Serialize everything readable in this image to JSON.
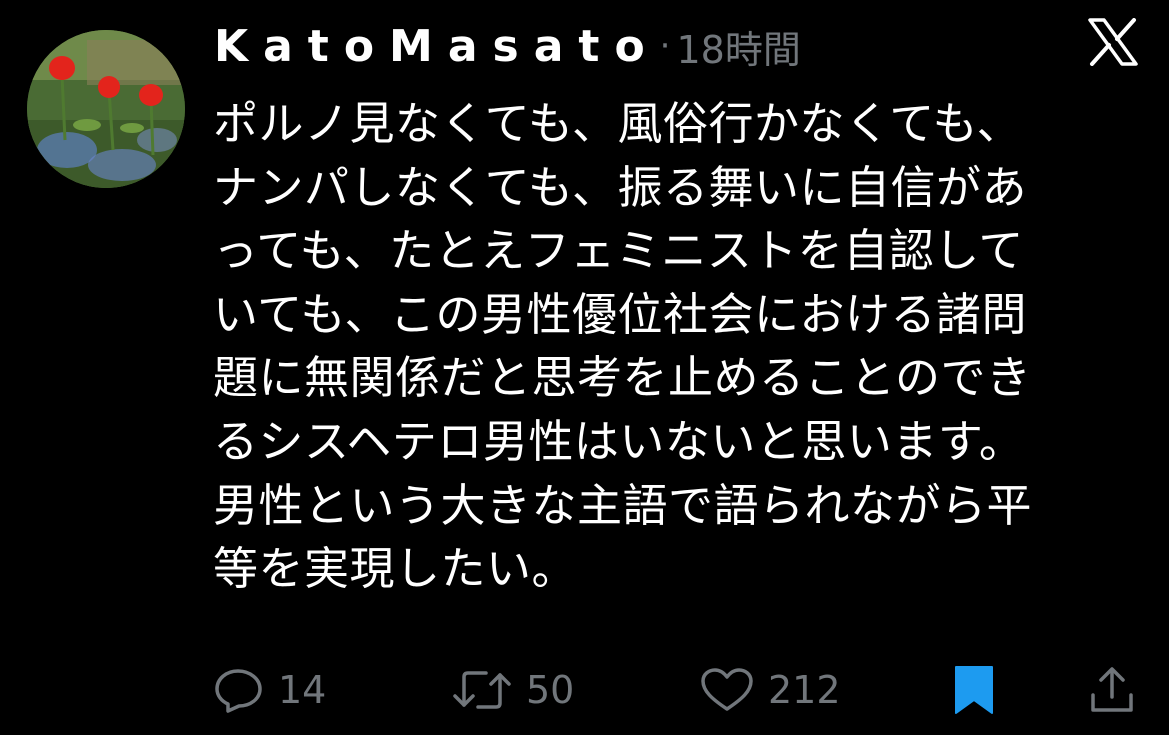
{
  "tweet": {
    "author": {
      "display_name": "KatoMasato",
      "avatar_icon": "tulips-avatar"
    },
    "separator": "·",
    "timestamp": "18時間",
    "brand_icon": "x-logo-icon",
    "text_lines": [
      "ポルノ見なくても、風俗行かなくても、",
      "ナンパしなくても、振る舞いに自信があ",
      "っても、たとえフェミニストを自認して",
      "いても、この男性優位社会における諸問",
      "題に無関係だと思考を止めることのでき",
      "るシスヘテロ男性はいないと思います。",
      "男性という大きな主語で語られながら平",
      "等を実現したい。"
    ],
    "actions": {
      "reply": {
        "icon": "reply-icon",
        "count": "14"
      },
      "retweet": {
        "icon": "retweet-icon",
        "count": "50"
      },
      "like": {
        "icon": "heart-icon",
        "count": "212"
      },
      "bookmark": {
        "icon": "bookmark-icon",
        "state": "bookmarked"
      },
      "share": {
        "icon": "share-icon"
      }
    },
    "colors": {
      "background": "#000000",
      "text": "#ffffff",
      "secondary": "#71767b",
      "bookmark_active": "#1d9bf0"
    }
  }
}
